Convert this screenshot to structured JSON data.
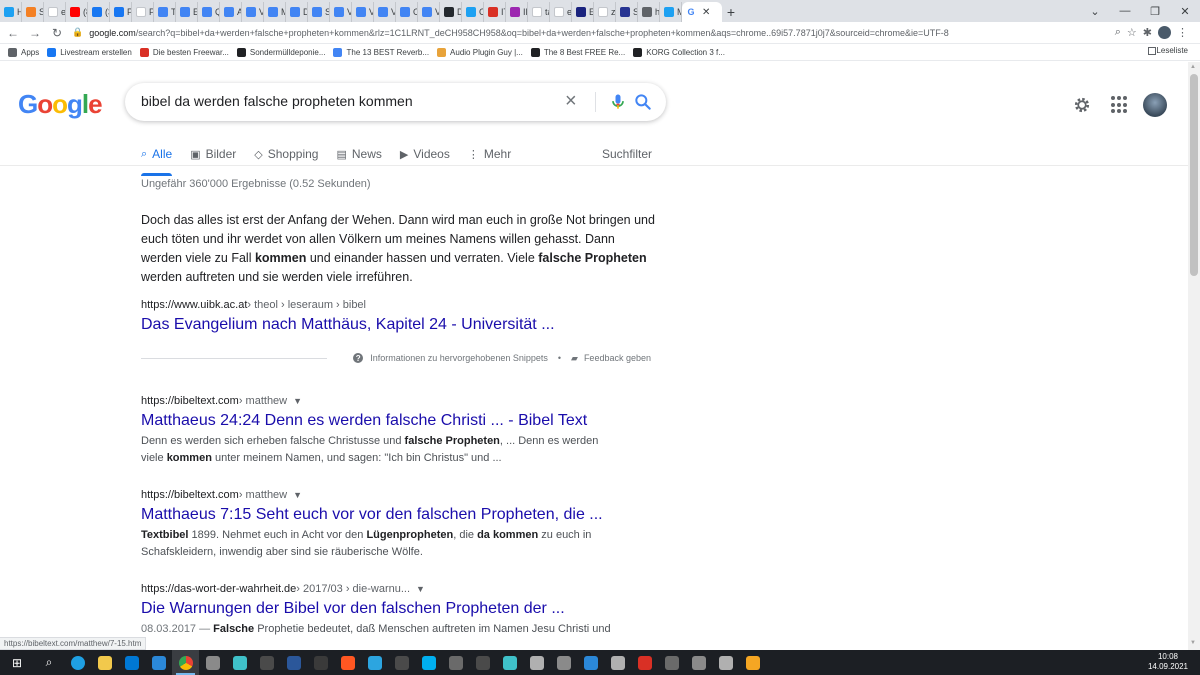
{
  "browser": {
    "tabs": [
      {
        "label": "Hi",
        "color": "#1da1f2"
      },
      {
        "label": "St",
        "color": "#f48024"
      },
      {
        "label": "en",
        "color": "#ffffff"
      },
      {
        "label": "(8",
        "color": "#ff0000"
      },
      {
        "label": "(3",
        "color": "#1877f2"
      },
      {
        "label": "Ps",
        "color": "#1877f2"
      },
      {
        "label": "Ps",
        "color": "#ffffff"
      },
      {
        "label": "Tu",
        "color": "#4285f4"
      },
      {
        "label": "Ex",
        "color": "#4285f4"
      },
      {
        "label": "Q",
        "color": "#4285f4"
      },
      {
        "label": "Ar",
        "color": "#4285f4"
      },
      {
        "label": "VS",
        "color": "#4285f4"
      },
      {
        "label": "M",
        "color": "#4285f4"
      },
      {
        "label": "Dr",
        "color": "#4285f4"
      },
      {
        "label": "Sc",
        "color": "#4285f4"
      },
      {
        "label": "VS",
        "color": "#4285f4"
      },
      {
        "label": "VS",
        "color": "#4285f4"
      },
      {
        "label": "VS",
        "color": "#4285f4"
      },
      {
        "label": "Or",
        "color": "#4285f4"
      },
      {
        "label": "VS",
        "color": "#4285f4"
      },
      {
        "label": "Di",
        "color": "#24292e"
      },
      {
        "label": "Cl",
        "color": "#1da1f2"
      },
      {
        "label": "IT",
        "color": "#d93025"
      },
      {
        "label": "IL",
        "color": "#9c27b0"
      },
      {
        "label": "ta",
        "color": "#ffffff"
      },
      {
        "label": "er",
        "color": "#ffffff"
      },
      {
        "label": "EF",
        "color": "#1a237e"
      },
      {
        "label": "zc",
        "color": "#ffffff"
      },
      {
        "label": "Sc",
        "color": "#283593"
      },
      {
        "label": "ht",
        "color": "#5f6368"
      },
      {
        "label": "M",
        "color": "#1da1f2"
      }
    ],
    "active_tab": {
      "label": "G",
      "close": "✕"
    },
    "new_tab": "+",
    "url_host": "google.com",
    "url_rest": "/search?q=bibel+da+werden+falsche+propheten+kommen&rlz=1C1LRNT_deCH958CH958&oq=bibel+da+werden+falsche+propheten+kommen&aqs=chrome..69i57.7871j0j7&sourceid=chrome&ie=UTF-8",
    "bookmarks": [
      {
        "label": "Apps",
        "color": "#5f6368"
      },
      {
        "label": "Livestream erstellen",
        "color": "#1877f2"
      },
      {
        "label": "Die besten Freewar...",
        "color": "#d93025"
      },
      {
        "label": "Sondermülldeponie...",
        "color": "#202124"
      },
      {
        "label": "The 13 BEST Reverb...",
        "color": "#4285f4"
      },
      {
        "label": "Audio Plugin Guy |...",
        "color": "#e8a33a"
      },
      {
        "label": "The 8 Best FREE Re...",
        "color": "#202124"
      },
      {
        "label": "KORG Collection 3 f...",
        "color": "#202124"
      }
    ],
    "reading_list": "Leseliste",
    "status_url": "https://bibeltext.com/matthew/7-15.htm"
  },
  "google": {
    "logo": [
      "G",
      "o",
      "o",
      "g",
      "l",
      "e"
    ],
    "query": "bibel da werden falsche propheten kommen",
    "tabs": [
      {
        "label": "Alle",
        "icon": "⌕"
      },
      {
        "label": "Bilder",
        "icon": "▣"
      },
      {
        "label": "Shopping",
        "icon": "◇"
      },
      {
        "label": "News",
        "icon": "▤"
      },
      {
        "label": "Videos",
        "icon": "▶"
      },
      {
        "label": "Mehr",
        "icon": "⋮"
      }
    ],
    "tools": "Suchfilter",
    "stats": "Ungefähr 360'000 Ergebnisse (0.52 Sekunden)"
  },
  "featured": {
    "text_1": "Doch das alles ist erst der Anfang der Wehen. Dann wird man euch in große Not bringen und euch töten und ihr werdet von allen Völkern um meines Namens willen gehasst. Dann werden viele zu Fall ",
    "bold_1": "kommen",
    "text_2": " und einander hassen und verraten. Viele ",
    "bold_2": "falsche Propheten",
    "text_3": " werden auftreten und sie werden viele irreführen.",
    "url": "https://www.uibk.ac.at",
    "crumb": " › theol › leseraum › bibel",
    "title": "Das Evangelium nach Matthäus, Kapitel 24 - Universität ...",
    "info": "Informationen zu hervorgehobenen Snippets",
    "feedback": "Feedback geben"
  },
  "results": [
    {
      "url": "https://bibeltext.com",
      "crumb": " › matthew",
      "title": "Matthaeus 24:24 Denn es werden falsche Christi ... - Bibel Text",
      "d1": "Denn es werden sich erheben falsche Christusse und ",
      "b1": "falsche Propheten",
      "d2": ", ... Denn es werden viele ",
      "b2": "kommen",
      "d3": " unter meinem Namen, und sagen: \"Ich bin Christus\" und ..."
    },
    {
      "url": "https://bibeltext.com",
      "crumb": " › matthew",
      "title": "Matthaeus 7:15 Seht euch vor vor den falschen Propheten, die ...",
      "b0": "Textbibel",
      "d1": " 1899. Nehmet euch in Acht vor den ",
      "b1": "Lügenpropheten",
      "d2": ", die ",
      "b2": "da kommen",
      "d3": " zu euch in Schafskleidern, inwendig aber sind sie räuberische Wölfe."
    },
    {
      "url": "https://das-wort-der-wahrheit.de",
      "crumb": " › 2017/03 › die-warnu...",
      "title": "Die Warnungen der Bibel vor den falschen Propheten der ...",
      "date": "08.03.2017 — ",
      "b1": "Falsche",
      "d1": " Prophetie bedeutet, daß Menschen auftreten im Namen Jesu Christi und"
    }
  ],
  "taskbar": {
    "time": "10:08",
    "date": "14.09.2021",
    "apps": [
      {
        "name": "windows-start",
        "color": "#ffffff"
      },
      {
        "name": "search",
        "color": "#ffffff"
      },
      {
        "name": "edge",
        "color": "#1fa0e3"
      },
      {
        "name": "file-explorer",
        "color": "#f2c94c"
      },
      {
        "name": "store",
        "color": "#0078d4"
      },
      {
        "name": "mail",
        "color": "#2b88d8"
      },
      {
        "name": "chrome",
        "color": "#ea4335"
      },
      {
        "name": "app-8",
        "color": "#8a8a8a"
      },
      {
        "name": "app-9",
        "color": "#3fc1c9"
      },
      {
        "name": "app-10",
        "color": "#4a4a4a"
      },
      {
        "name": "app-11",
        "color": "#2b579a"
      },
      {
        "name": "app-12",
        "color": "#3a3a3a"
      },
      {
        "name": "app-13",
        "color": "#ff5722"
      },
      {
        "name": "telegram",
        "color": "#2ca5e0"
      },
      {
        "name": "app-15",
        "color": "#4a4a4a"
      },
      {
        "name": "skype",
        "color": "#00aff0"
      },
      {
        "name": "app-17",
        "color": "#6a6a6a"
      },
      {
        "name": "app-18",
        "color": "#4a4a4a"
      },
      {
        "name": "app-19",
        "color": "#3fc1c9"
      },
      {
        "name": "app-20",
        "color": "#b0b0b0"
      },
      {
        "name": "app-21",
        "color": "#8a8a8a"
      },
      {
        "name": "app-22",
        "color": "#2b88d8"
      },
      {
        "name": "app-23",
        "color": "#b0b0b0"
      },
      {
        "name": "app-24",
        "color": "#d93025"
      },
      {
        "name": "app-25",
        "color": "#6a6a6a"
      },
      {
        "name": "app-26",
        "color": "#8a8a8a"
      },
      {
        "name": "app-27",
        "color": "#b0b0b0"
      },
      {
        "name": "app-28",
        "color": "#f5a623"
      }
    ]
  }
}
